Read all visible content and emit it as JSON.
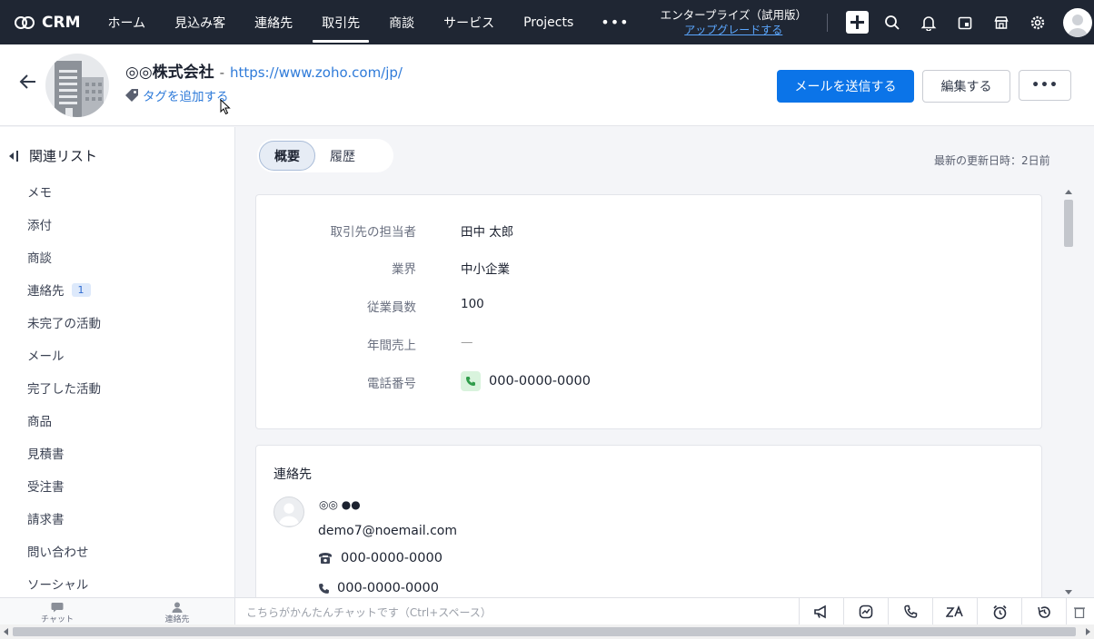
{
  "topnav": {
    "brand": "CRM",
    "items": [
      {
        "label": "ホーム",
        "active": false
      },
      {
        "label": "見込み客",
        "active": false
      },
      {
        "label": "連絡先",
        "active": false
      },
      {
        "label": "取引先",
        "active": true
      },
      {
        "label": "商談",
        "active": false
      },
      {
        "label": "サービス",
        "active": false
      },
      {
        "label": "Projects",
        "active": false
      }
    ],
    "more": "•••",
    "edition_name": "エンタープライズ（試用版）",
    "upgrade_link": "アップグレードする"
  },
  "header": {
    "account_name": "◎◎株式会社",
    "separator": "-",
    "website": "https://www.zoho.com/jp/",
    "add_tag": "タグを追加する",
    "send_email": "メールを送信する",
    "edit": "編集する",
    "more": "•••"
  },
  "sidebar": {
    "title": "関連リスト",
    "items": [
      {
        "label": "メモ"
      },
      {
        "label": "添付"
      },
      {
        "label": "商談"
      },
      {
        "label": "連絡先",
        "badge": "1"
      },
      {
        "label": "未完了の活動"
      },
      {
        "label": "メール"
      },
      {
        "label": "完了した活動"
      },
      {
        "label": "商品"
      },
      {
        "label": "見積書"
      },
      {
        "label": "受注書"
      },
      {
        "label": "請求書"
      },
      {
        "label": "問い合わせ"
      },
      {
        "label": "ソーシャル"
      }
    ]
  },
  "main": {
    "tabs": [
      {
        "label": "概要",
        "active": true
      },
      {
        "label": "履歴",
        "active": false
      }
    ],
    "last_modified": "最新の更新日時：2日前",
    "fields": [
      {
        "label": "取引先の担当者",
        "value": "田中 太郎"
      },
      {
        "label": "業界",
        "value": "中小企業"
      },
      {
        "label": "従業員数",
        "value": "100"
      },
      {
        "label": "年間売上",
        "value": "—"
      },
      {
        "label": "電話番号",
        "value": "000-0000-0000"
      }
    ],
    "contacts_section": {
      "title": "連絡先",
      "name": "◎◎ ●●",
      "email": "demo7@noemail.com",
      "phone": "000-0000-0000",
      "mobile": "000-0000-0000"
    }
  },
  "bottombar": {
    "chat_label": "チャット",
    "contacts_label": "連絡先",
    "chat_placeholder": "こちらがかんたんチャットです（Ctrl+スペース）"
  },
  "colors": {
    "nav_bg": "#1f2633",
    "primary": "#0b74e8",
    "link": "#2f7bd9"
  }
}
